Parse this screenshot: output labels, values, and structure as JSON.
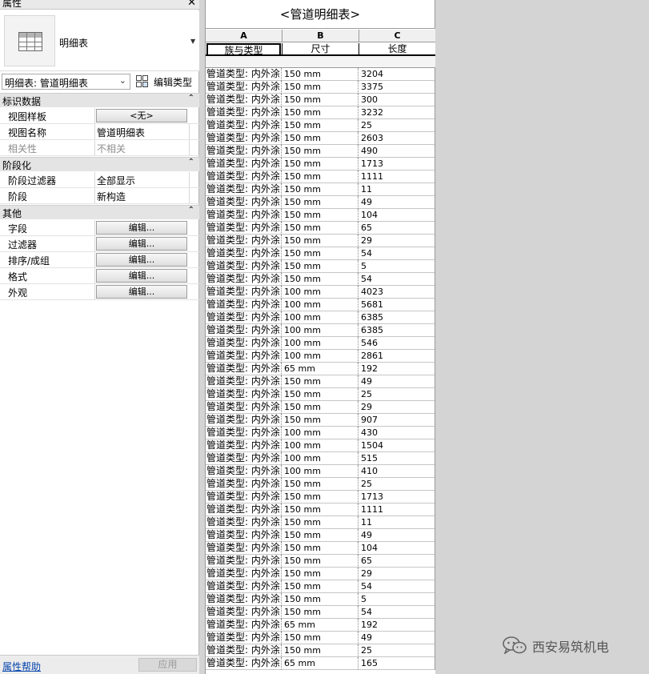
{
  "properties_panel": {
    "title": "属性",
    "close_glyph": "✕",
    "type_selector": {
      "name": "明细表"
    },
    "instance_selector": {
      "value": "明细表: 管道明细表",
      "edit_type_label": "编辑类型"
    },
    "groups": [
      {
        "label": "标识数据",
        "rows": [
          {
            "name": "视图样板",
            "value": "<无>",
            "kind": "button"
          },
          {
            "name": "视图名称",
            "value": "管道明细表",
            "kind": "text"
          },
          {
            "name": "相关性",
            "value": "不相关",
            "kind": "disabled"
          }
        ]
      },
      {
        "label": "阶段化",
        "rows": [
          {
            "name": "阶段过滤器",
            "value": "全部显示",
            "kind": "text"
          },
          {
            "name": "阶段",
            "value": "新构造",
            "kind": "text"
          }
        ]
      },
      {
        "label": "其他",
        "rows": [
          {
            "name": "字段",
            "value": "编辑...",
            "kind": "button"
          },
          {
            "name": "过滤器",
            "value": "编辑...",
            "kind": "button"
          },
          {
            "name": "排序/成组",
            "value": "编辑...",
            "kind": "button"
          },
          {
            "name": "格式",
            "value": "编辑...",
            "kind": "button"
          },
          {
            "name": "外观",
            "value": "编辑...",
            "kind": "button"
          }
        ]
      }
    ],
    "help_link": "属性帮助",
    "apply_label": "应用"
  },
  "schedule": {
    "title": "<管道明细表>",
    "column_letters": [
      "A",
      "B",
      "C"
    ],
    "column_headers": [
      "族与类型",
      "尺寸",
      "长度"
    ],
    "type_label": "管道类型: 内外涂",
    "rows": [
      [
        "150 mm",
        "3204"
      ],
      [
        "150 mm",
        "3375"
      ],
      [
        "150 mm",
        "300"
      ],
      [
        "150 mm",
        "3232"
      ],
      [
        "150 mm",
        "25"
      ],
      [
        "150 mm",
        "2603"
      ],
      [
        "150 mm",
        "490"
      ],
      [
        "150 mm",
        "1713"
      ],
      [
        "150 mm",
        "1111"
      ],
      [
        "150 mm",
        "11"
      ],
      [
        "150 mm",
        "49"
      ],
      [
        "150 mm",
        "104"
      ],
      [
        "150 mm",
        "65"
      ],
      [
        "150 mm",
        "29"
      ],
      [
        "150 mm",
        "54"
      ],
      [
        "150 mm",
        "5"
      ],
      [
        "150 mm",
        "54"
      ],
      [
        "100 mm",
        "4023"
      ],
      [
        "100 mm",
        "5681"
      ],
      [
        "100 mm",
        "6385"
      ],
      [
        "100 mm",
        "6385"
      ],
      [
        "100 mm",
        "546"
      ],
      [
        "100 mm",
        "2861"
      ],
      [
        "65 mm",
        "192"
      ],
      [
        "150 mm",
        "49"
      ],
      [
        "150 mm",
        "25"
      ],
      [
        "150 mm",
        "29"
      ],
      [
        "150 mm",
        "907"
      ],
      [
        "100 mm",
        "430"
      ],
      [
        "100 mm",
        "1504"
      ],
      [
        "100 mm",
        "515"
      ],
      [
        "100 mm",
        "410"
      ],
      [
        "150 mm",
        "25"
      ],
      [
        "150 mm",
        "1713"
      ],
      [
        "150 mm",
        "1111"
      ],
      [
        "150 mm",
        "11"
      ],
      [
        "150 mm",
        "49"
      ],
      [
        "150 mm",
        "104"
      ],
      [
        "150 mm",
        "65"
      ],
      [
        "150 mm",
        "29"
      ],
      [
        "150 mm",
        "54"
      ],
      [
        "150 mm",
        "5"
      ],
      [
        "150 mm",
        "54"
      ],
      [
        "65 mm",
        "192"
      ],
      [
        "150 mm",
        "49"
      ],
      [
        "150 mm",
        "25"
      ],
      [
        "65 mm",
        "165"
      ]
    ]
  },
  "watermark": {
    "text": "西安易筑机电",
    "icon": "wechat-icon"
  }
}
